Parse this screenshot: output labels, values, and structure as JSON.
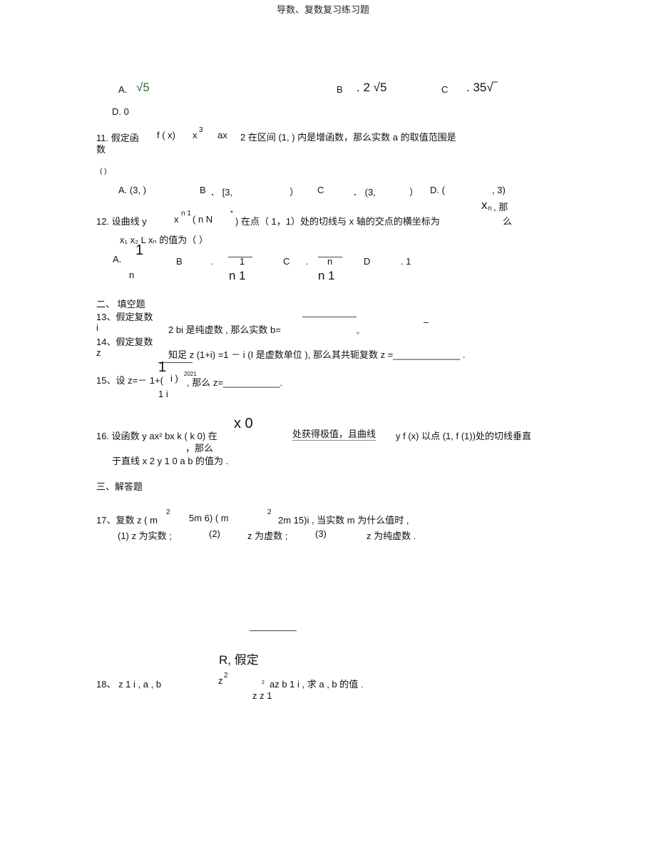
{
  "header": {
    "title": "导数、复数复习练习题"
  },
  "q10": {
    "a": "A.",
    "a_val": "√5",
    "b": "B",
    "b_val": ". 2 √5",
    "c": "C",
    "c_val": ". 35√‾",
    "d": "D. 0"
  },
  "q11": {
    "text1": "11. 假定函",
    "fx": "f ( x)",
    "x3": "x",
    "exp3": "3",
    "ax": "ax",
    "rest": "2 在区间 (1,      ) 内是增函数，那么实数 a 的取值范围是",
    "wrap": "数",
    "paren": "(          )",
    "options": [
      "A. (3,     )",
      "B",
      "． [3,",
      "）",
      "C",
      "． (3,",
      "）",
      "D. (",
      ", 3)"
    ]
  },
  "q12": {
    "xn_top": "x",
    "xn_sub": "n",
    "na": ", 那",
    "text": "12. 设曲线 y",
    "xn": "x",
    "exp": "n 1",
    "rest": "( n    N",
    "star": "*",
    "rest2": ") 在点（ 1，1）处的切线与  x 轴的交点的横坐标为",
    "me": "么",
    "line2": "x₁  x₂  L   xₙ 的值为（      ）",
    "a": "A.",
    "a_num": "1",
    "a_den": "n",
    "b": "B",
    "b_dot": ".",
    "b_num": "1",
    "b_den": "n  1",
    "c": "C",
    "c_dot": ".",
    "c_num": "n",
    "c_den": "n   1",
    "d": "D",
    "d_val": ". 1"
  },
  "section2": "二、  填空题",
  "q13": {
    "l1": "13、假定复数",
    "i": "i",
    "rest": "2   bi 是纯虚数 , 那么实数  b=",
    "dot": "。",
    "dash": "–"
  },
  "q14": {
    "l1": "14、假定复数",
    "z": "z",
    "rest": "知足 z (1+i) =1     － i (I    是虚数单位  ), 那么其共轭复数   z =_____________ ."
  },
  "q15": {
    "l1": "15、设 z=－ 1+(",
    "num": "1",
    "i": "i )",
    "exp": "2021",
    "then": ", 那么  z=___________.",
    "den": "1  i"
  },
  "q16": {
    "l1": "16. 设函数  y     ax² bx   k ( k       0) 在",
    "x0": "x 0",
    "mid": "处获得极值，且曲线",
    "rest": "y   f (x) 以点 (1, f (1))处的切线垂直",
    "na": "，那么",
    "l2": "于直线  x    2 y  1     0     a       b 的值为           ."
  },
  "section3": "三、解答题",
  "q17": {
    "l1": "17、复数  z  ( m",
    "exp1": "2",
    "mid": "5m    6)  ( m",
    "exp2": "2",
    "rest": "2m    15)i , 当实数  m 为什么值时 ,",
    "l2a": "(1)  z 为实数 ;",
    "l2b": "(2)",
    "l2c": "z 为虚数 ;",
    "l2d": "(3)",
    "l2e": "z 为纯虚数 ."
  },
  "q18": {
    "r": "R, 假定",
    "l1": "18、  z  1  i , a , b",
    "z2": "z",
    "exp": "2",
    "sub2": "2",
    "mid": "az     b  1  i , 求 a , b 的值 .",
    "den": "z    z    1"
  }
}
